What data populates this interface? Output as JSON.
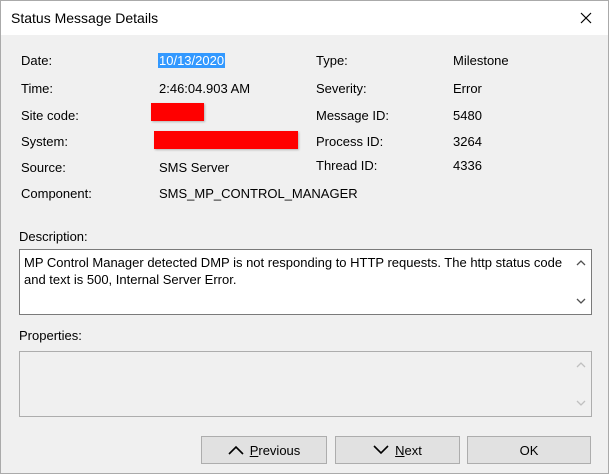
{
  "window": {
    "title": "Status Message Details"
  },
  "fields": {
    "date_label": "Date:",
    "date_value": "10/13/2020",
    "time_label": "Time:",
    "time_value": "2:46:04.903 AM",
    "site_code_label": "Site code:",
    "system_label": "System:",
    "source_label": "Source:",
    "source_value": "SMS Server",
    "component_label": "Component:",
    "component_value": "SMS_MP_CONTROL_MANAGER",
    "type_label": "Type:",
    "type_value": "Milestone",
    "severity_label": "Severity:",
    "severity_value": "Error",
    "message_id_label": "Message ID:",
    "message_id_value": "5480",
    "process_id_label": "Process ID:",
    "process_id_value": "3264",
    "thread_id_label": "Thread ID:",
    "thread_id_value": "4336"
  },
  "description": {
    "label": "Description:",
    "text": "MP Control Manager detected DMP is not responding to HTTP requests.  The http status code and text is 500, Internal Server Error."
  },
  "properties": {
    "label": "Properties:",
    "text": ""
  },
  "buttons": {
    "previous_prefix": "",
    "previous_ul": "P",
    "previous_rest": "revious",
    "next_ul": "N",
    "next_rest": "ext",
    "ok": "OK"
  },
  "colors": {
    "selection": "#3399ff",
    "redaction": "#ff0000"
  }
}
